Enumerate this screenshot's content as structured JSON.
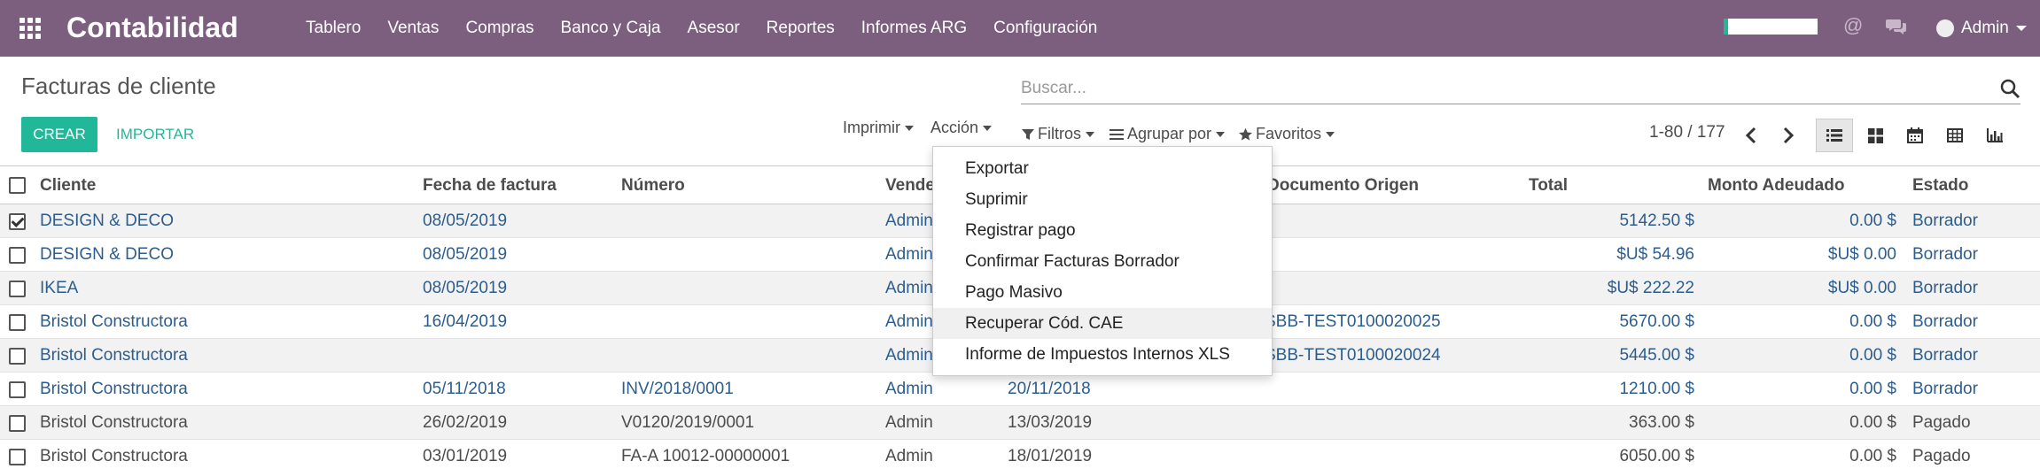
{
  "navbar": {
    "brand": "Contabilidad",
    "menu": [
      "Tablero",
      "Ventas",
      "Compras",
      "Banco y Caja",
      "Asesor",
      "Reportes",
      "Informes ARG",
      "Configuración"
    ],
    "at_symbol": "@",
    "user": "Admin"
  },
  "control": {
    "title": "Facturas de cliente",
    "search_placeholder": "Buscar...",
    "create": "CREAR",
    "import": "IMPORTAR",
    "print": "Imprimir",
    "action": "Acción",
    "filters": "Filtros",
    "group_by": "Agrupar por",
    "favorites": "Favoritos",
    "pager": "1-80 / 177"
  },
  "columns": {
    "cliente": "Cliente",
    "fecha": "Fecha de factura",
    "numero": "Número",
    "vendedor": "Vende",
    "documento": "Documento Origen",
    "total": "Total",
    "monto": "Monto Adeudado",
    "estado": "Estado"
  },
  "rows": [
    {
      "cliente": "DESIGN & DECO",
      "fecha": "08/05/2019",
      "numero": "",
      "vendedor": "Admin",
      "vence": "",
      "documento": "",
      "total": "5142.50 $",
      "monto": "0.00 $",
      "estado": "Borrador",
      "checked": true,
      "link": true
    },
    {
      "cliente": "DESIGN & DECO",
      "fecha": "08/05/2019",
      "numero": "",
      "vendedor": "Admin",
      "vence": "",
      "documento": "",
      "total": "$U$ 54.96",
      "monto": "$U$ 0.00",
      "estado": "Borrador",
      "checked": false,
      "link": true
    },
    {
      "cliente": "IKEA",
      "fecha": "08/05/2019",
      "numero": "",
      "vendedor": "Admin",
      "vence": "",
      "documento": "",
      "total": "$U$ 222.22",
      "monto": "$U$ 0.00",
      "estado": "Borrador",
      "checked": false,
      "link": true
    },
    {
      "cliente": "Bristol Constructora",
      "fecha": "16/04/2019",
      "numero": "",
      "vendedor": "Admin",
      "vence": "",
      "documento": "SBB-TEST0100020025",
      "total": "5670.00 $",
      "monto": "0.00 $",
      "estado": "Borrador",
      "checked": false,
      "link": true
    },
    {
      "cliente": "Bristol Constructora",
      "fecha": "",
      "numero": "",
      "vendedor": "Admin",
      "vence": "",
      "documento": "SBB-TEST0100020024",
      "total": "5445.00 $",
      "monto": "0.00 $",
      "estado": "Borrador",
      "checked": false,
      "link": true
    },
    {
      "cliente": "Bristol Constructora",
      "fecha": "05/11/2018",
      "numero": "INV/2018/0001",
      "vendedor": "Admin",
      "vence": "20/11/2018",
      "documento": "",
      "total": "1210.00 $",
      "monto": "0.00 $",
      "estado": "Borrador",
      "checked": false,
      "link": true
    },
    {
      "cliente": "Bristol Constructora",
      "fecha": "26/02/2019",
      "numero": "V0120/2019/0001",
      "vendedor": "Admin",
      "vence": "13/03/2019",
      "documento": "",
      "total": "363.00 $",
      "monto": "0.00 $",
      "estado": "Pagado",
      "checked": false,
      "link": false
    },
    {
      "cliente": "Bristol Constructora",
      "fecha": "03/01/2019",
      "numero": "FA-A 10012-00000001",
      "vendedor": "Admin",
      "vence": "18/01/2019",
      "documento": "",
      "total": "6050.00 $",
      "monto": "0.00 $",
      "estado": "Pagado",
      "checked": false,
      "link": false
    }
  ],
  "action_menu": [
    "Exportar",
    "Suprimir",
    "Registrar pago",
    "Confirmar Facturas Borrador",
    "Pago Masivo",
    "Recuperar Cód. CAE",
    "Informe de Impuestos Internos XLS"
  ],
  "colors": {
    "navbar": "#7c5f7e",
    "primary": "#21b799",
    "link": "#2c5d8e"
  }
}
